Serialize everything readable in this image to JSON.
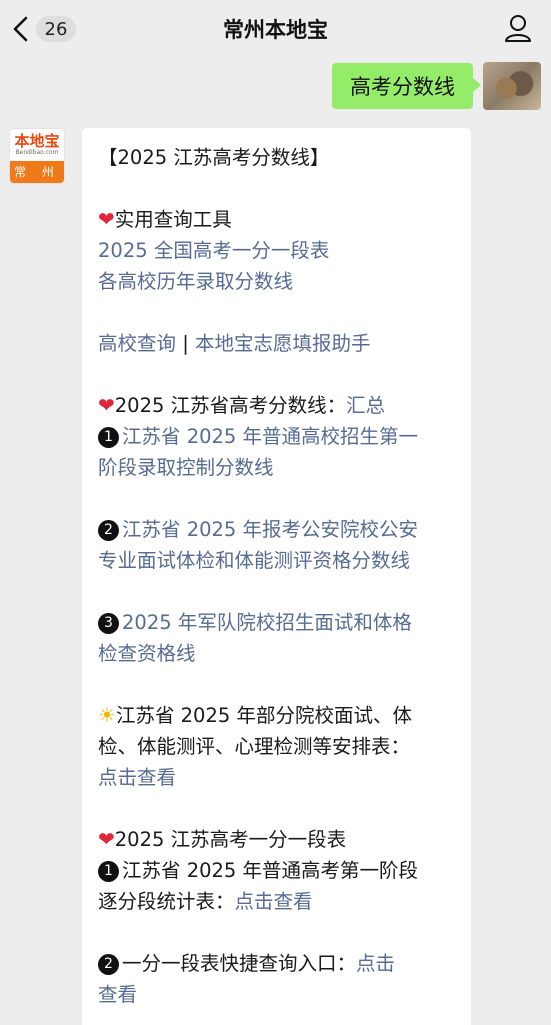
{
  "header": {
    "unread_count": "26",
    "title": "常州本地宝"
  },
  "outgoing": {
    "text": "高考分数线"
  },
  "bot_avatar": {
    "brand": "本地宝",
    "domain": "Bendibao.com",
    "city": "常 州"
  },
  "message": {
    "heading": "【2025 江苏高考分数线】",
    "tools_title": "实用查询工具",
    "tool_link_1": "2025 全国高考一分一段表",
    "tool_link_2": "各高校历年录取分数线",
    "tool_link_3": "高校查询",
    "tool_sep": " | ",
    "tool_link_4": "本地宝志愿填报助手",
    "summary_title": "2025 江苏省高考分数线：",
    "summary_link": "汇总",
    "item1_num": "1",
    "item1_line1": "江苏省 2025 年普通高校招生第一",
    "item1_line2": "阶段录取控制分数线",
    "item2_num": "2",
    "item2_line1": "江苏省 2025 年报考公安院校公安",
    "item2_line2": "专业面试体检和体能测评资格分数线",
    "item3_num": "3",
    "item3_line1": "2025 年军队院校招生面试和体格",
    "item3_line2": "检查资格线",
    "sched_line1": "江苏省 2025 年部分院校面试、体",
    "sched_line2": "检、体能测评、心理检测等安排表：",
    "sched_link": "点击查看",
    "rank_title": "2025 江苏高考一分一段表",
    "rank1_num": "1",
    "rank1_line1": "江苏省 2025 年普通高考第一阶段",
    "rank1_line2_text": "逐分段统计表：",
    "rank1_link": "点击查看",
    "rank2_num": "2",
    "rank2_text": "一分一段表快捷查询入口：",
    "rank2_link_a": "点击",
    "rank2_link_b": "查看"
  },
  "colors": {
    "link": "#576b95",
    "bubble_green": "#95ec69",
    "background": "#ededed"
  }
}
